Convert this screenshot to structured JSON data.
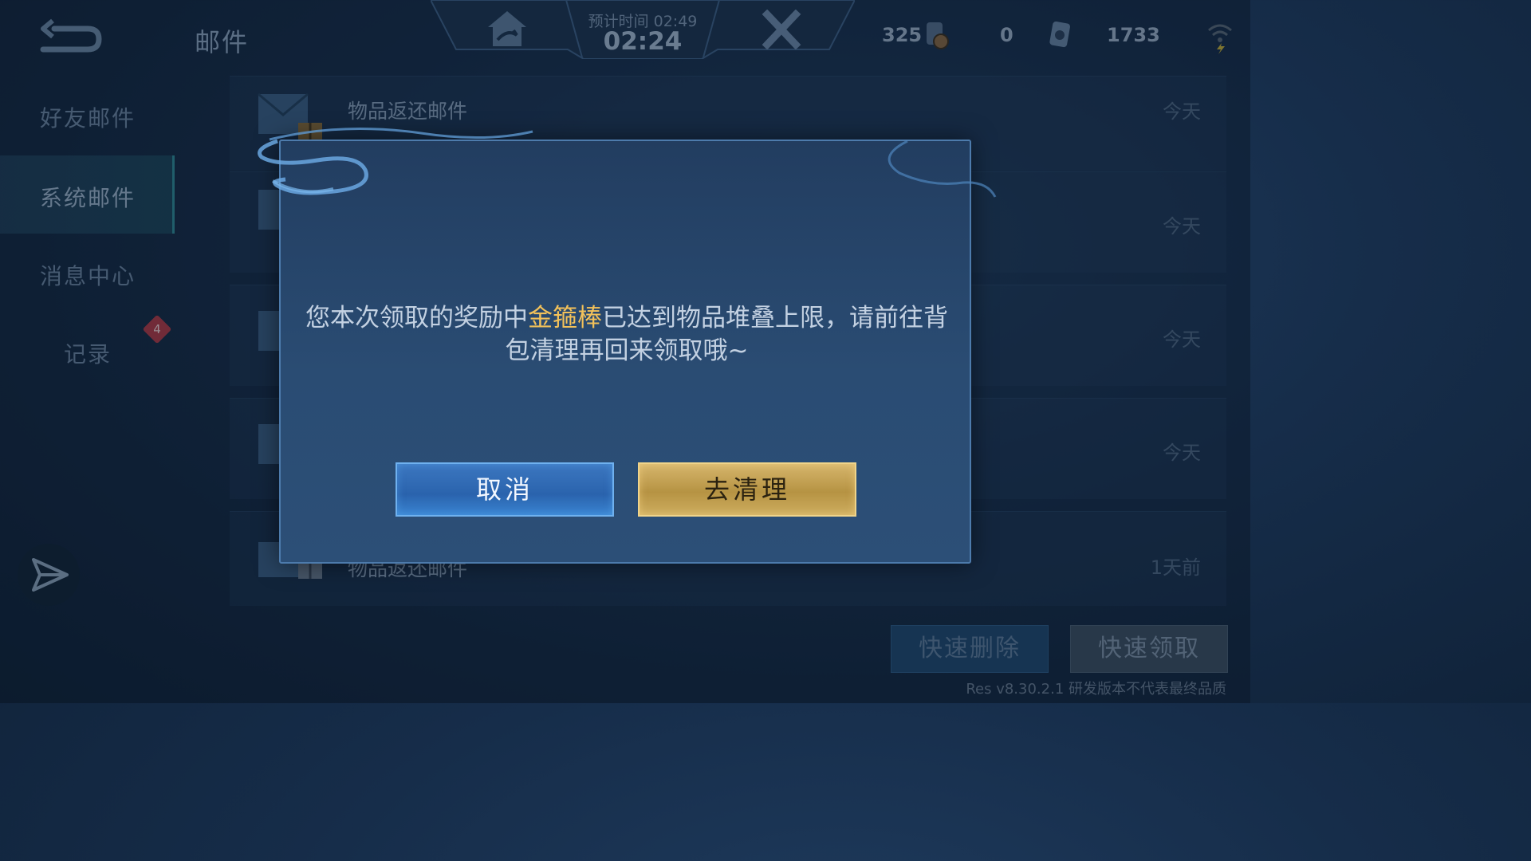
{
  "header": {
    "page_title": "邮件",
    "est_time": "预计时间 02:49",
    "current_time": "02:24"
  },
  "resources": [
    {
      "value": "325",
      "icon": "coin-token-icon"
    },
    {
      "value": "0",
      "icon": "ticket-icon"
    },
    {
      "value": "1733",
      "icon": "diamond-icon"
    }
  ],
  "sidebar": {
    "items": [
      {
        "label": "好友邮件"
      },
      {
        "label": "系统邮件"
      },
      {
        "label": "消息中心"
      },
      {
        "label": "记录"
      }
    ],
    "badge": "4"
  },
  "mail_list": [
    {
      "title": "物品返还邮件",
      "date": "今天"
    },
    {
      "title": "",
      "date": "今天"
    },
    {
      "title": "",
      "date": "今天"
    },
    {
      "title": "",
      "date": "今天"
    },
    {
      "title": "物品返还邮件",
      "date": "1天前"
    }
  ],
  "bottom": {
    "quick_delete": "快速删除",
    "quick_claim": "快速领取",
    "version_note": "Res v8.30.2.1 研发版本不代表最终品质"
  },
  "modal": {
    "msg_before": "您本次领取的奖励中",
    "msg_highlight": "金箍棒",
    "msg_after": "已达到物品堆叠上限，请前往背包清理再回来领取哦~",
    "cancel_label": "取消",
    "clean_label": "去清理",
    "highlight_color": "#f2c15a"
  }
}
